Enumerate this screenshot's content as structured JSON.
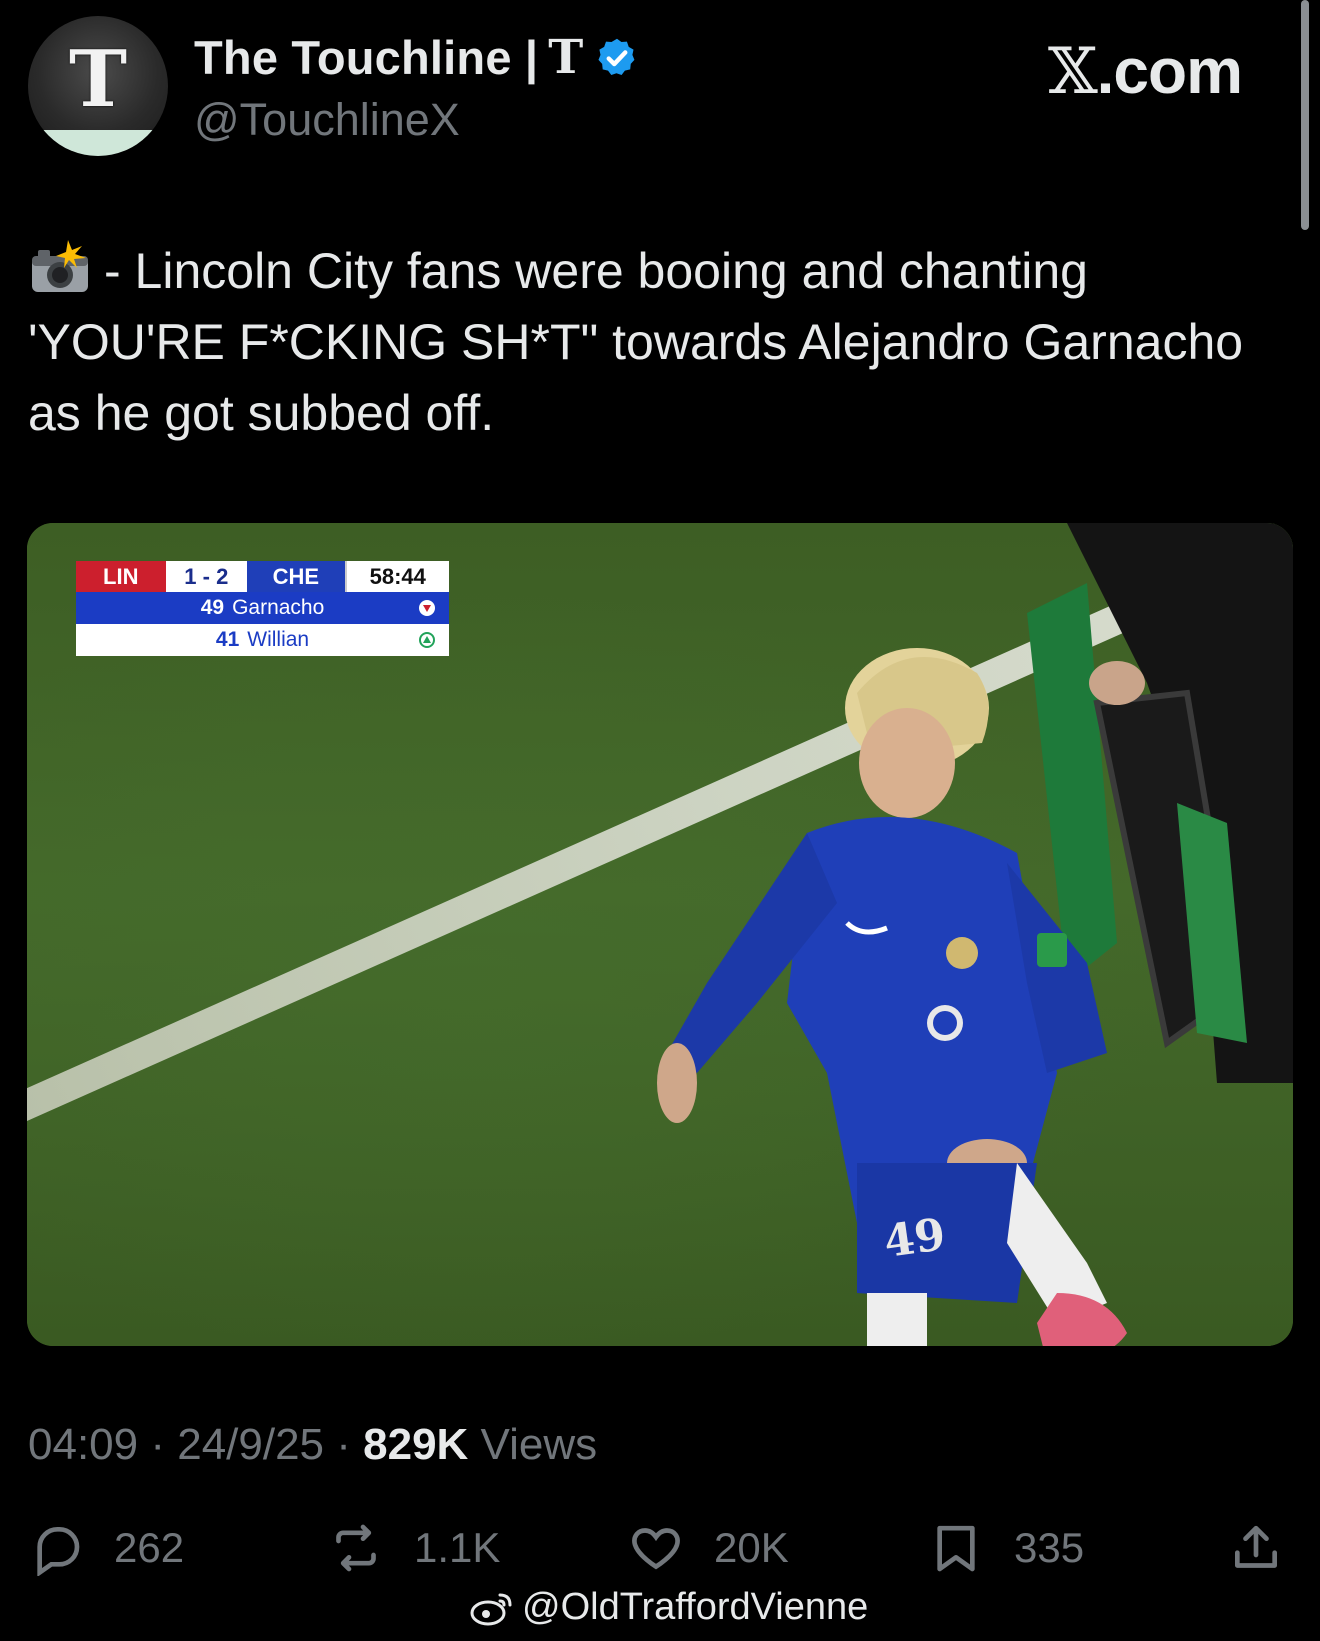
{
  "header": {
    "display_name": "The Touchline |",
    "display_suffix": "T",
    "handle": "@TouchlineX",
    "site_label": ".com",
    "verified_color": "#1d9bf0"
  },
  "tweet": {
    "text": "- Lincoln City fans were booing and chanting 'YOU'RE F*CKING SH*T\" towards Alejandro Garnacho as he got subbed off.",
    "icon": "camera-flash-icon"
  },
  "media": {
    "scoreboard": {
      "home": "LIN",
      "score": "1 - 2",
      "away": "CHE",
      "clock": "58:44",
      "off_number": "49",
      "off_name": "Garnacho",
      "on_number": "41",
      "on_name": "Willian"
    },
    "shirt_number": "49"
  },
  "meta": {
    "time": "04:09",
    "sep1": " · ",
    "date": "24/9/25",
    "sep2": " · ",
    "views_count": "829K",
    "views_label": " Views"
  },
  "actions": {
    "replies": "262",
    "reposts": "1.1K",
    "likes": "20K",
    "bookmarks": "335"
  },
  "watermark": {
    "text": "@OldTraffordVienne"
  }
}
